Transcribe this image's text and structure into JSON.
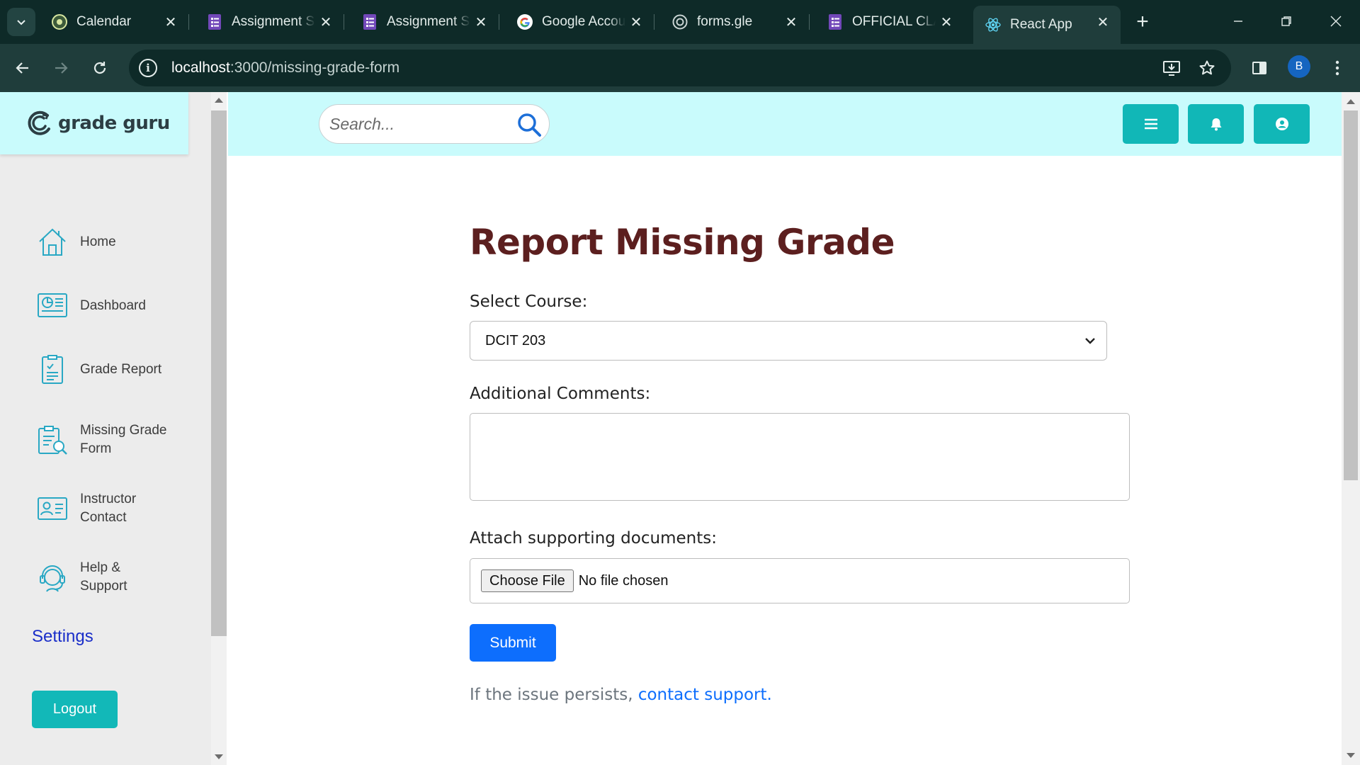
{
  "browser": {
    "tabs": [
      {
        "title": "Calendar",
        "icon": "calendar-favicon-icon"
      },
      {
        "title": "Assignment Su",
        "icon": "google-forms-icon"
      },
      {
        "title": "Assignment Su",
        "icon": "google-forms-icon"
      },
      {
        "title": "Google Accou",
        "icon": "google-g-icon"
      },
      {
        "title": "forms.gle",
        "icon": "globe-icon"
      },
      {
        "title": "OFFICIAL CLA",
        "icon": "google-forms-icon"
      },
      {
        "title": "React App",
        "icon": "react-icon",
        "active": true
      }
    ],
    "url_host": "localhost",
    "url_path": ":3000/missing-grade-form",
    "profile_initial": "B"
  },
  "app": {
    "brand": "grade guru",
    "search_placeholder": "Search...",
    "sidebar": {
      "items": [
        {
          "label": "Home",
          "icon": "home-icon"
        },
        {
          "label": "Dashboard",
          "icon": "dashboard-icon"
        },
        {
          "label": "Grade Report",
          "icon": "grade-report-icon"
        },
        {
          "label": "Missing Grade\nForm",
          "icon": "missing-grade-form-icon"
        },
        {
          "label": "Instructor\nContact",
          "icon": "instructor-contact-icon"
        },
        {
          "label": "Help &\nSupport",
          "icon": "help-support-icon"
        }
      ],
      "settings_label": "Settings",
      "logout_label": "Logout"
    },
    "header_buttons": [
      "menu-icon",
      "bell-icon",
      "user-icon"
    ],
    "accent_color": "#12b8b8",
    "header_bg": "#c9fbfc"
  },
  "form": {
    "title": "Report Missing Grade",
    "course_label": "Select Course:",
    "course_value": "DCIT 203",
    "comments_label": "Additional Comments:",
    "comments_value": "",
    "attach_label": "Attach supporting documents:",
    "choose_file_label": "Choose File",
    "no_file_text": "No file chosen",
    "submit_label": "Submit",
    "footer_prefix": "If the issue persists, ",
    "footer_link": "contact support",
    "footer_suffix": "."
  }
}
